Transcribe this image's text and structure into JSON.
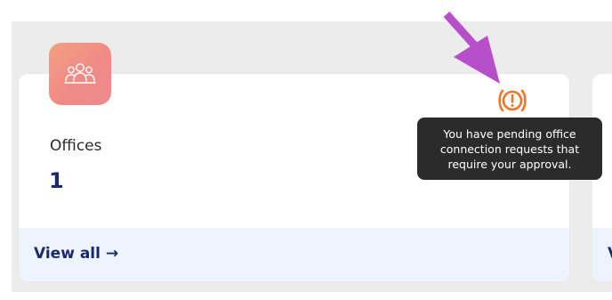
{
  "card": {
    "title": "Offices",
    "count": "1",
    "icon": "office-people-icon",
    "link_label": "View all →"
  },
  "next_card": {
    "link_partial": "V"
  },
  "alert": {
    "icon": "exclamation-circle-icon",
    "color": "#f0742a",
    "tooltip": "You have pending office connection requests that require your approval."
  },
  "annotation": {
    "icon": "arrow-pointer-icon",
    "color": "#b64fc9"
  },
  "colors": {
    "panel_bg": "#ececec",
    "card_bg": "#ffffff",
    "footer_bg": "#eef4fd",
    "title_text": "#2a2a2a",
    "accent_navy": "#1a2a6c",
    "icon_gradient_start": "#f3a080",
    "icon_gradient_end": "#ee8a8e",
    "tooltip_bg": "#2b2b2b"
  }
}
